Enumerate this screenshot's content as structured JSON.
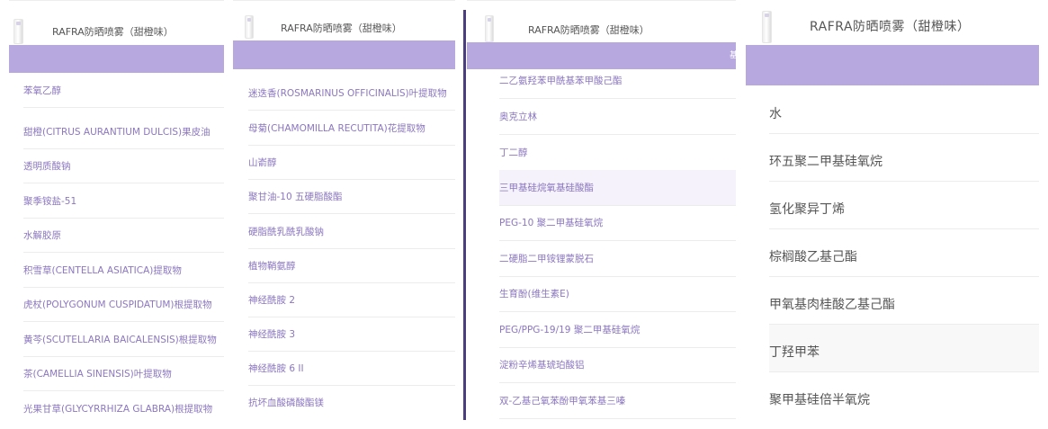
{
  "panels": [
    {
      "title": "RAFRA防晒喷雾（甜橙味）",
      "items": [
        "苯氧乙醇",
        "甜橙(CITRUS AURANTIUM DULCIS)果皮油",
        "透明质酸钠",
        "聚季铵盐-51",
        "水解胶原",
        "积雪草(CENTELLA ASIATICA)提取物",
        "虎杖(POLYGONUM CUSPIDATUM)根提取物",
        "黄芩(SCUTELLARIA BAICALENSIS)根提取物",
        "茶(CAMELLIA SINENSIS)叶提取物",
        "光果甘草(GLYCYRRHIZA GLABRA)根提取物"
      ]
    },
    {
      "title": "RAFRA防晒喷雾（甜橙味）",
      "items": [
        "迷迭香(ROSMARINUS OFFICINALIS)叶提取物",
        "母菊(CHAMOMILLA RECUTITA)花提取物",
        "山嵛醇",
        "聚甘油-10 五硬脂酸酯",
        "硬脂酰乳酰乳酸钠",
        "植物鞘氨醇",
        "神经酰胺 2",
        "神经酰胺 3",
        "神经酰胺 6 II",
        "抗坏血酸磷酸酯镁"
      ]
    },
    {
      "title": "RAFRA防晒喷雾（甜橙味）",
      "band_text": "基",
      "items": [
        "二乙氨羟苯甲酰基苯甲酸己酯",
        "奥克立林",
        "丁二醇",
        "三甲基硅烷氧基硅酸酯",
        "PEG-10 聚二甲基硅氧烷",
        "二硬脂二甲铵锂蒙脱石",
        "生育酚(维生素E)",
        "PEG/PPG-19/19 聚二甲基硅氧烷",
        "淀粉辛烯基琥珀酸铝",
        "双-乙基己氧苯酚甲氧苯基三嗪"
      ]
    },
    {
      "title": "RAFRA防晒喷雾（甜橙味）",
      "items": [
        "水",
        "环五聚二甲基硅氧烷",
        "氢化聚异丁烯",
        "棕榈酸乙基己酯",
        "甲氧基肉桂酸乙基己酯",
        "丁羟甲苯",
        "聚甲基硅倍半氧烷"
      ]
    }
  ],
  "colors": {
    "header_band": "#b8a8e0",
    "item_text": "#8b77bf",
    "title_text": "#555555",
    "divider": "#4a3f7c"
  }
}
